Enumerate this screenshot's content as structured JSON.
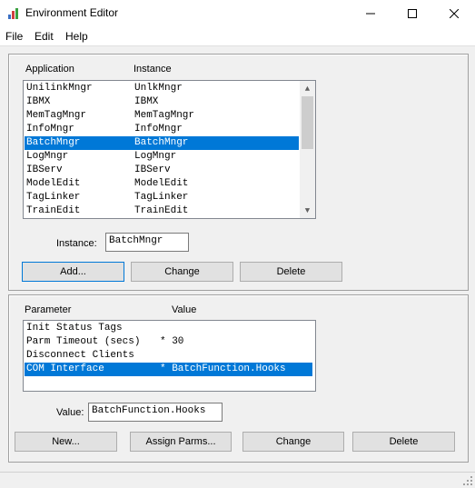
{
  "window": {
    "title": "Environment Editor"
  },
  "menu": [
    "File",
    "Edit",
    "Help"
  ],
  "app_panel": {
    "col_application": "Application",
    "col_instance": "Instance",
    "rows": [
      {
        "app": "UnilinkMngr",
        "inst": "UnlkMngr",
        "selected": false
      },
      {
        "app": "IBMX",
        "inst": "IBMX",
        "selected": false
      },
      {
        "app": "MemTagMngr",
        "inst": "MemTagMngr",
        "selected": false
      },
      {
        "app": "InfoMngr",
        "inst": "InfoMngr",
        "selected": false
      },
      {
        "app": "BatchMngr",
        "inst": "BatchMngr",
        "selected": true
      },
      {
        "app": "LogMngr",
        "inst": "LogMngr",
        "selected": false
      },
      {
        "app": "IBServ",
        "inst": "IBServ",
        "selected": false
      },
      {
        "app": "ModelEdit",
        "inst": "ModelEdit",
        "selected": false
      },
      {
        "app": "TagLinker",
        "inst": "TagLinker",
        "selected": false
      },
      {
        "app": "TrainEdit",
        "inst": "TrainEdit",
        "selected": false
      }
    ],
    "instance_label": "Instance:",
    "instance_value": "BatchMngr",
    "btn_add": "Add...",
    "btn_change": "Change",
    "btn_delete": "Delete"
  },
  "param_panel": {
    "col_parameter": "Parameter",
    "col_value": "Value",
    "rows": [
      {
        "param": "Init Status Tags",
        "value": "",
        "selected": false
      },
      {
        "param": "Parm Timeout (secs)",
        "value": "* 30",
        "selected": false
      },
      {
        "param": "Disconnect Clients",
        "value": "",
        "selected": false
      },
      {
        "param": "COM Interface",
        "value": "* BatchFunction.Hooks",
        "selected": true
      }
    ],
    "value_label": "Value:",
    "value_value": "BatchFunction.Hooks",
    "btn_new": "New...",
    "btn_assign": "Assign Parms...",
    "btn_change": "Change",
    "btn_delete": "Delete"
  },
  "colors": {
    "selection": "#0078d7",
    "window_bg": "#f0f0f0"
  },
  "icons": [
    "app-icon",
    "minimize-icon",
    "maximize-icon",
    "close-icon",
    "scroll-up-icon",
    "scroll-down-icon",
    "size-grip-icon"
  ]
}
